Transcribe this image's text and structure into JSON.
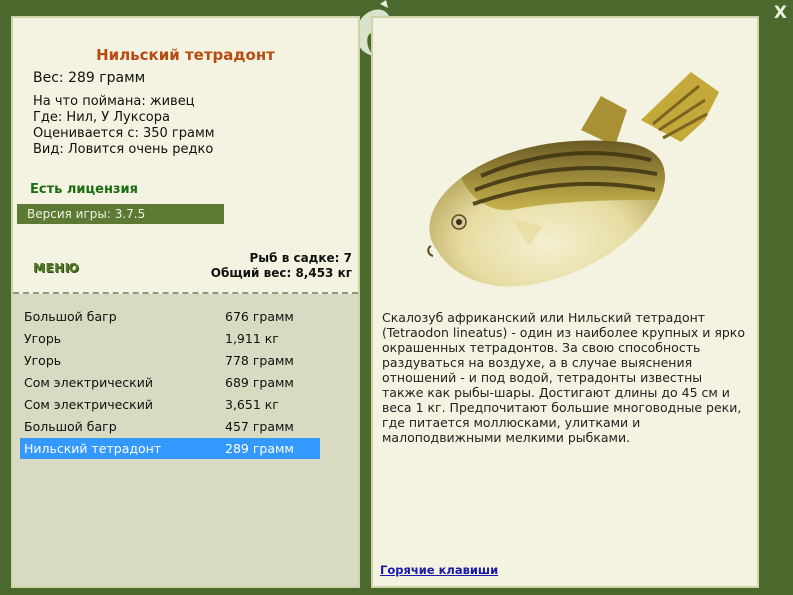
{
  "fish": {
    "name": "Нильский тетрадонт",
    "weight_line": "Вес: 289 грамм",
    "caught_with": "На что поймана: живец",
    "location": "Где: Нил, У Луксора",
    "valued_from": "Оценивается с: 350 грамм",
    "rarity": "Вид: Ловится очень редко"
  },
  "license": "Есть лицензия",
  "version": "Версия игры: 3.7.5",
  "menu_label": "МЕНЮ",
  "stats": {
    "count": "Рыб в садке: 7",
    "total": "Общий вес: 8,453 кг"
  },
  "catch": [
    {
      "name": "Большой багр",
      "weight": "676 грамм"
    },
    {
      "name": "Угорь",
      "weight": "1,911 кг"
    },
    {
      "name": "Угорь",
      "weight": "778 грамм"
    },
    {
      "name": "Сом электрический",
      "weight": "689 грамм"
    },
    {
      "name": "Сом электрический",
      "weight": "3,651 кг"
    },
    {
      "name": "Большой багр",
      "weight": "457 грамм"
    },
    {
      "name": "Нильский тетрадонт",
      "weight": "289 грамм"
    }
  ],
  "selected_index": 6,
  "description": "Скалозуб африканский или Нильский тетрадонт (Tetraodon lineatus) - один из наиболее крупных и ярко окрашенных тетрадонтов. За свою способность раздуваться на воздухе, а в случае выяснения отношений - и под водой, тетрадонты известны также как рыбы-шары. Достигают длины до 45 см и веса 1 кг. Предпочитают большие многоводные реки, где питается моллюсками, улитками и малоподвижными мелкими рыбками.",
  "hotkeys": "Горячие клавиши",
  "close_label": "X",
  "colors": {
    "frame": "#4b692c",
    "panel": "#f4f2e0",
    "title": "#b84a12",
    "license": "#1a6b12",
    "selection": "#3399ff"
  }
}
